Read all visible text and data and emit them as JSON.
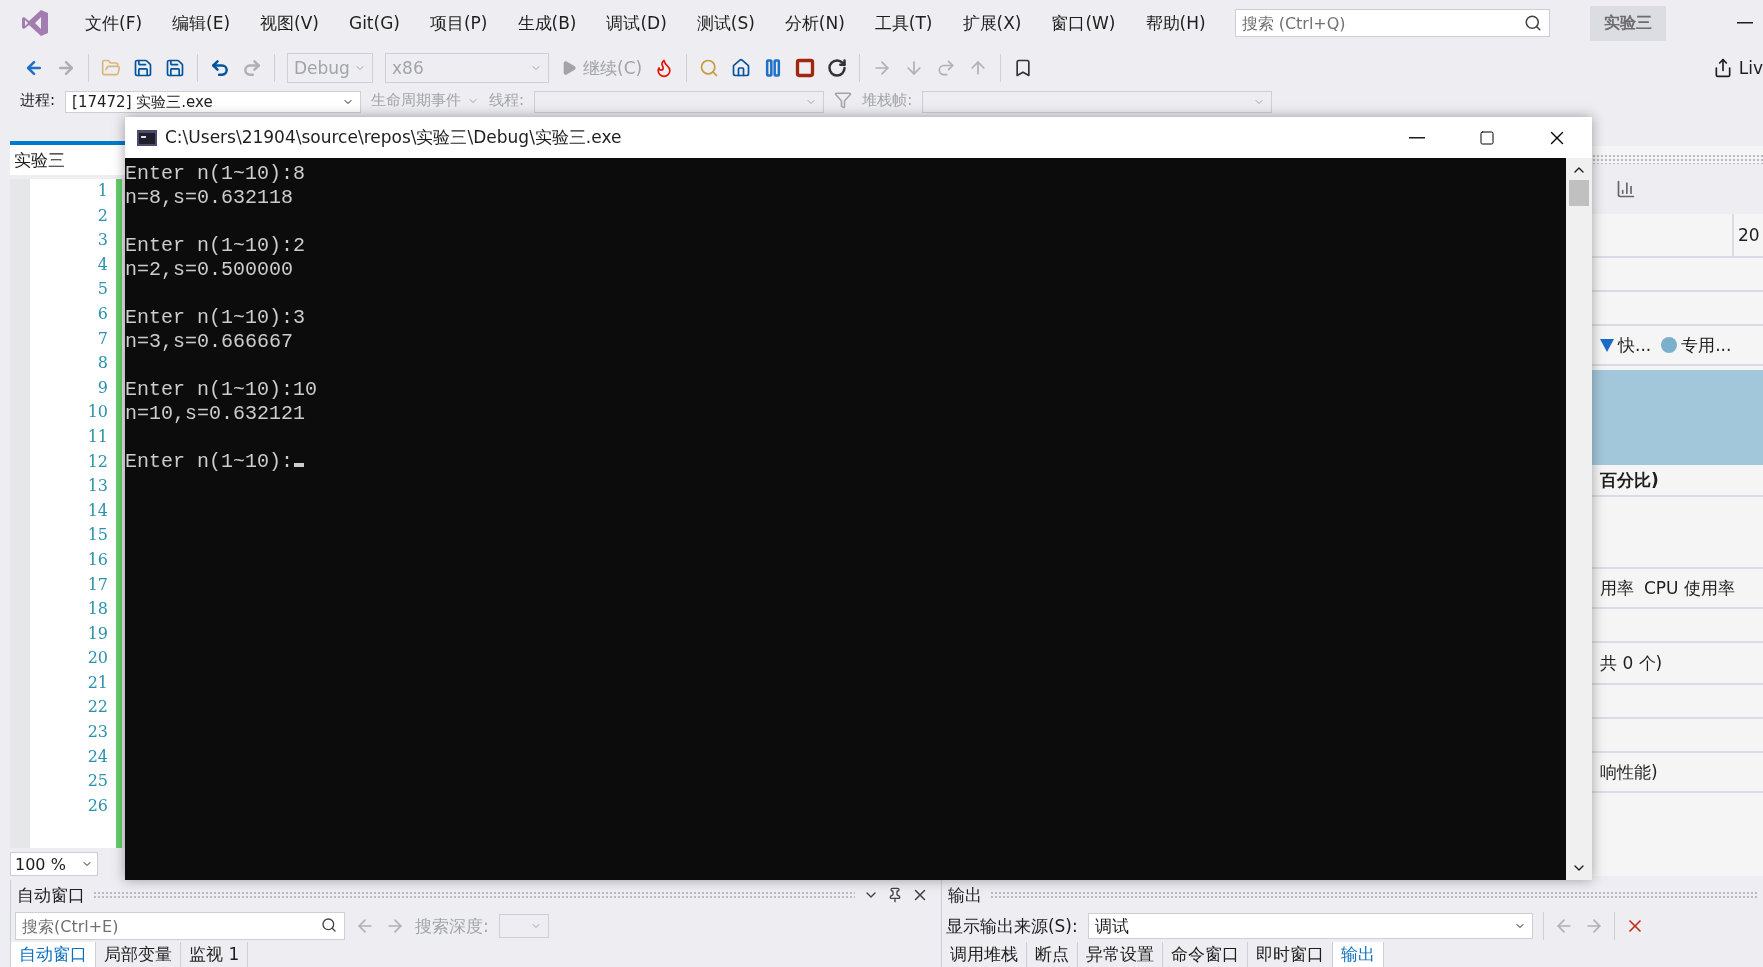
{
  "menu": [
    "文件(F)",
    "编辑(E)",
    "视图(V)",
    "Git(G)",
    "项目(P)",
    "生成(B)",
    "调试(D)",
    "测试(S)",
    "分析(N)",
    "工具(T)",
    "扩展(X)",
    "窗口(W)",
    "帮助(H)"
  ],
  "quick_search": {
    "placeholder": "搜索 (Ctrl+Q)"
  },
  "solution_badge": "实验三",
  "toolbar": {
    "configuration": "Debug",
    "platform": "x86",
    "continue": "继续(C)",
    "live_share": "Liv"
  },
  "debug_location": {
    "process_label": "进程:",
    "process": "[17472] 实验三.exe",
    "lifecycle": "生命周期事件",
    "thread_label": "线程:",
    "stack_frame_label": "堆栈帧:"
  },
  "editor": {
    "tab": "实验三",
    "line_numbers": [
      "1",
      "2",
      "3",
      "4",
      "5",
      "6",
      "7",
      "8",
      "9",
      "10",
      "11",
      "12",
      "13",
      "14",
      "15",
      "16",
      "17",
      "18",
      "19",
      "20",
      "21",
      "22",
      "23",
      "24",
      "25",
      "26"
    ],
    "zoom": "100 %"
  },
  "console": {
    "title": "C:\\Users\\21904\\source\\repos\\实验三\\Debug\\实验三.exe",
    "runs": [
      {
        "prompt": "Enter n(1~10):8",
        "result": "n=8,s=0.632118"
      },
      {
        "prompt": "Enter n(1~10):2",
        "result": "n=2,s=0.500000"
      },
      {
        "prompt": "Enter n(1~10):3",
        "result": "n=3,s=0.666667"
      },
      {
        "prompt": "Enter n(1~10):10",
        "result": "n=10,s=0.632121"
      }
    ],
    "current_prompt": "Enter n(1~10):"
  },
  "diagnostics": {
    "timeline_label": "20",
    "legend": [
      {
        "label": "快...",
        "kind": "triangle",
        "color": "#1b6ac9"
      },
      {
        "label": "专用...",
        "kind": "dot",
        "color": "#7ab0cc"
      }
    ],
    "heading": "百分比)",
    "columns": [
      "用率",
      "CPU 使用率"
    ],
    "count": "共 0 个)",
    "note": "响性能)"
  },
  "autos": {
    "title": "自动窗口",
    "search": {
      "placeholder": "搜索(Ctrl+E)"
    },
    "depth_label": "搜索深度:",
    "tabs": [
      {
        "label": "自动窗口",
        "selected": true
      },
      {
        "label": "局部变量",
        "selected": false
      },
      {
        "label": "监视 1",
        "selected": false
      }
    ]
  },
  "output": {
    "title": "输出",
    "source_label": "显示输出来源(S):",
    "source": "调试",
    "tabs": [
      {
        "label": "调用堆栈",
        "selected": false
      },
      {
        "label": "断点",
        "selected": false
      },
      {
        "label": "异常设置",
        "selected": false
      },
      {
        "label": "命令窗口",
        "selected": false
      },
      {
        "label": "即时窗口",
        "selected": false
      },
      {
        "label": "输出",
        "selected": true
      }
    ]
  }
}
